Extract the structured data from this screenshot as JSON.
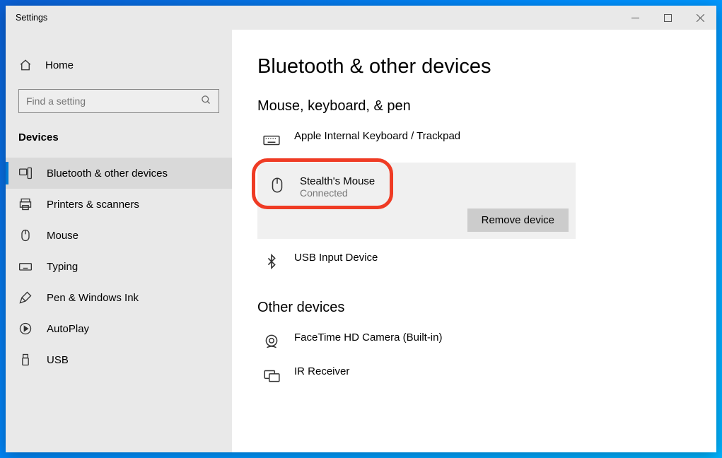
{
  "window": {
    "title": "Settings"
  },
  "sidebar": {
    "home_label": "Home",
    "search_placeholder": "Find a setting",
    "section_label": "Devices",
    "items": [
      {
        "label": "Bluetooth & other devices"
      },
      {
        "label": "Printers & scanners"
      },
      {
        "label": "Mouse"
      },
      {
        "label": "Typing"
      },
      {
        "label": "Pen & Windows Ink"
      },
      {
        "label": "AutoPlay"
      },
      {
        "label": "USB"
      }
    ]
  },
  "main": {
    "heading": "Bluetooth & other devices",
    "section1": {
      "title": "Mouse, keyboard, & pen",
      "device0": {
        "name": "Apple Internal Keyboard / Trackpad"
      },
      "device1": {
        "name": "Stealth's Mouse",
        "status": "Connected",
        "remove_label": "Remove device"
      },
      "device2": {
        "name": "USB Input Device"
      }
    },
    "section2": {
      "title": "Other devices",
      "device0": {
        "name": "FaceTime HD Camera (Built-in)"
      },
      "device1": {
        "name": "IR Receiver"
      }
    }
  }
}
